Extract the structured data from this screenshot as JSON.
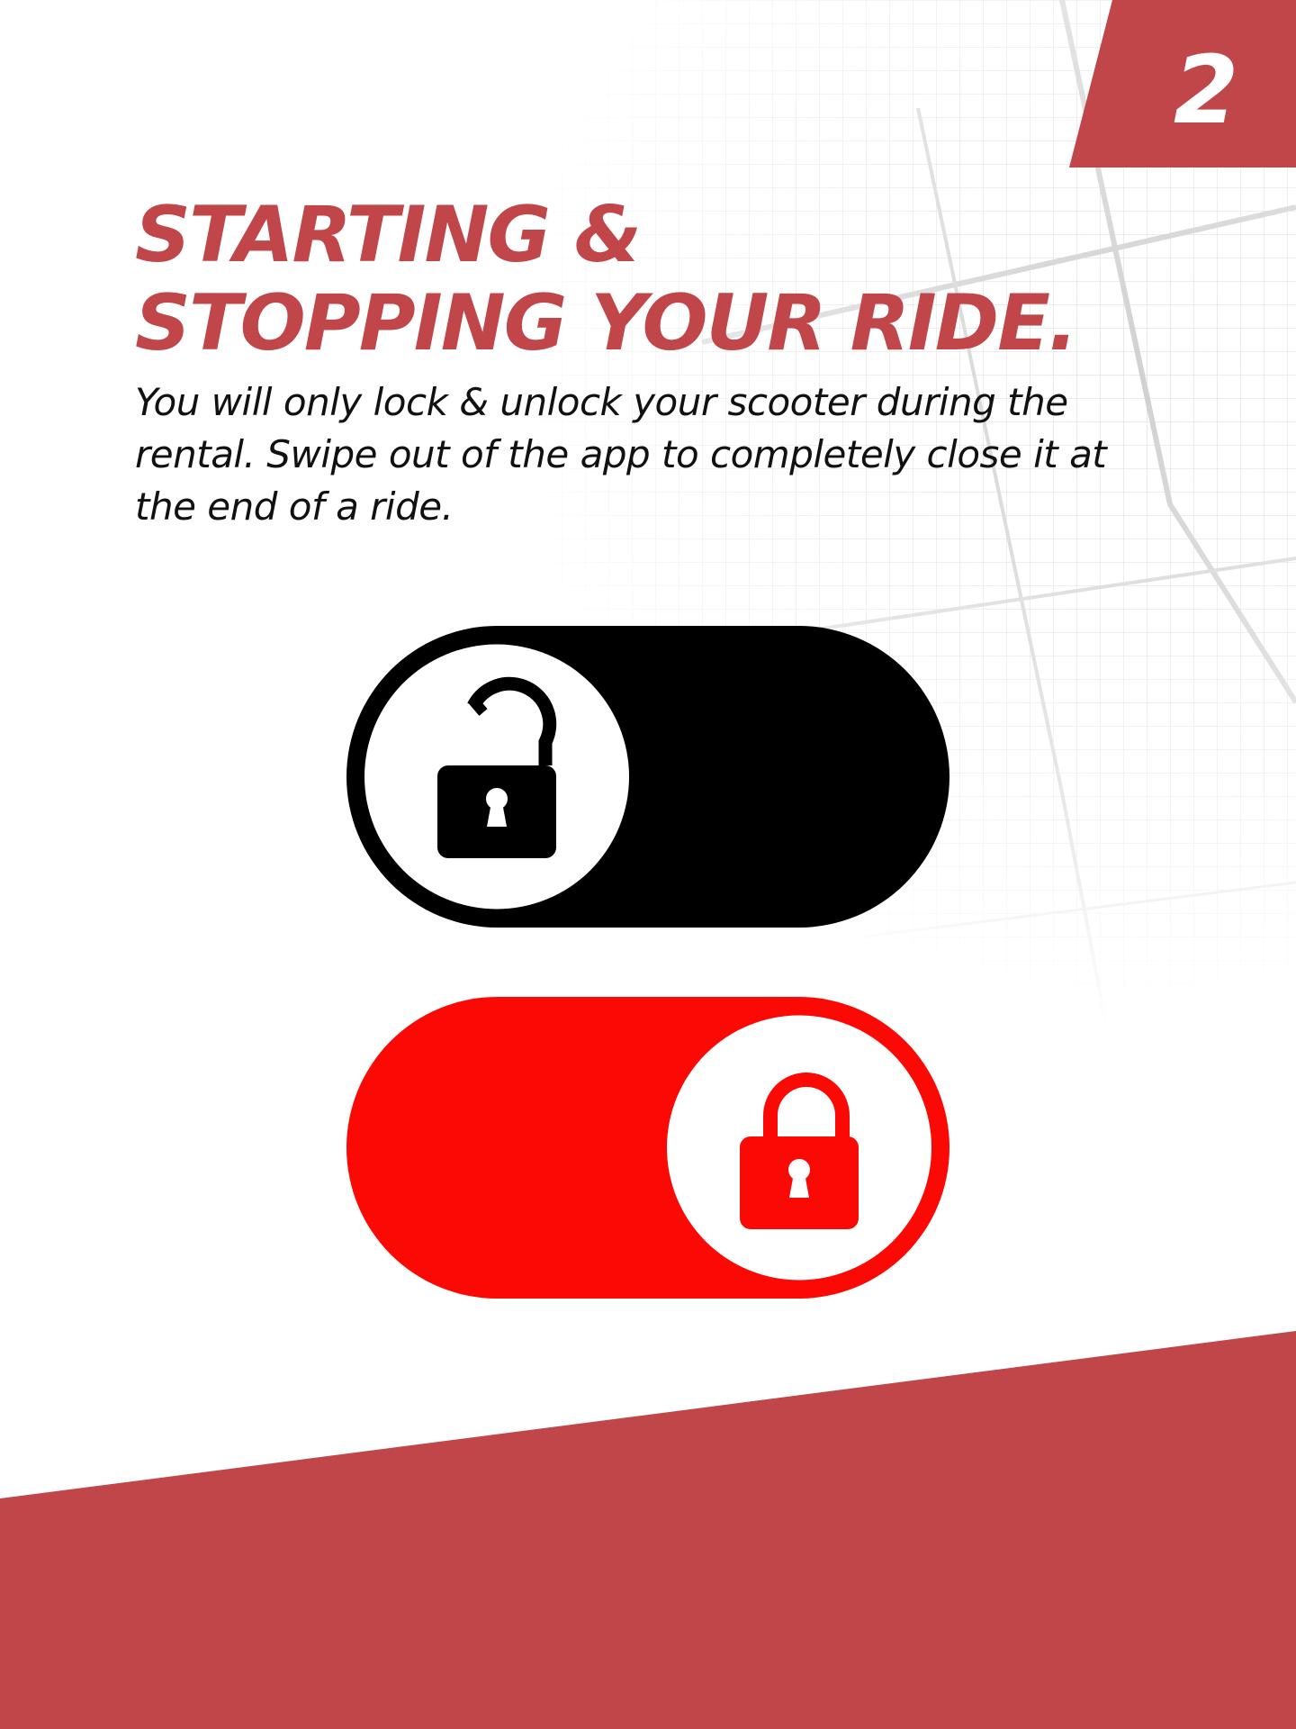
{
  "step_number": "2",
  "title": {
    "line1": "STARTING &",
    "line2": "STOPPING YOUR RIDE."
  },
  "intro_text": "You will only lock & unlock your scooter during the rental. Swipe out of the app to completely close it at the end of a ride.",
  "toggles": [
    {
      "state": "unlocked",
      "icon": "unlocked-padlock-icon",
      "track_color": "#000000"
    },
    {
      "state": "locked",
      "icon": "locked-padlock-icon",
      "track_color": "#fb0a05"
    }
  ],
  "colors": {
    "brand_red": "#c0464a",
    "lock_red": "#fb0a05",
    "text": "#111111"
  }
}
